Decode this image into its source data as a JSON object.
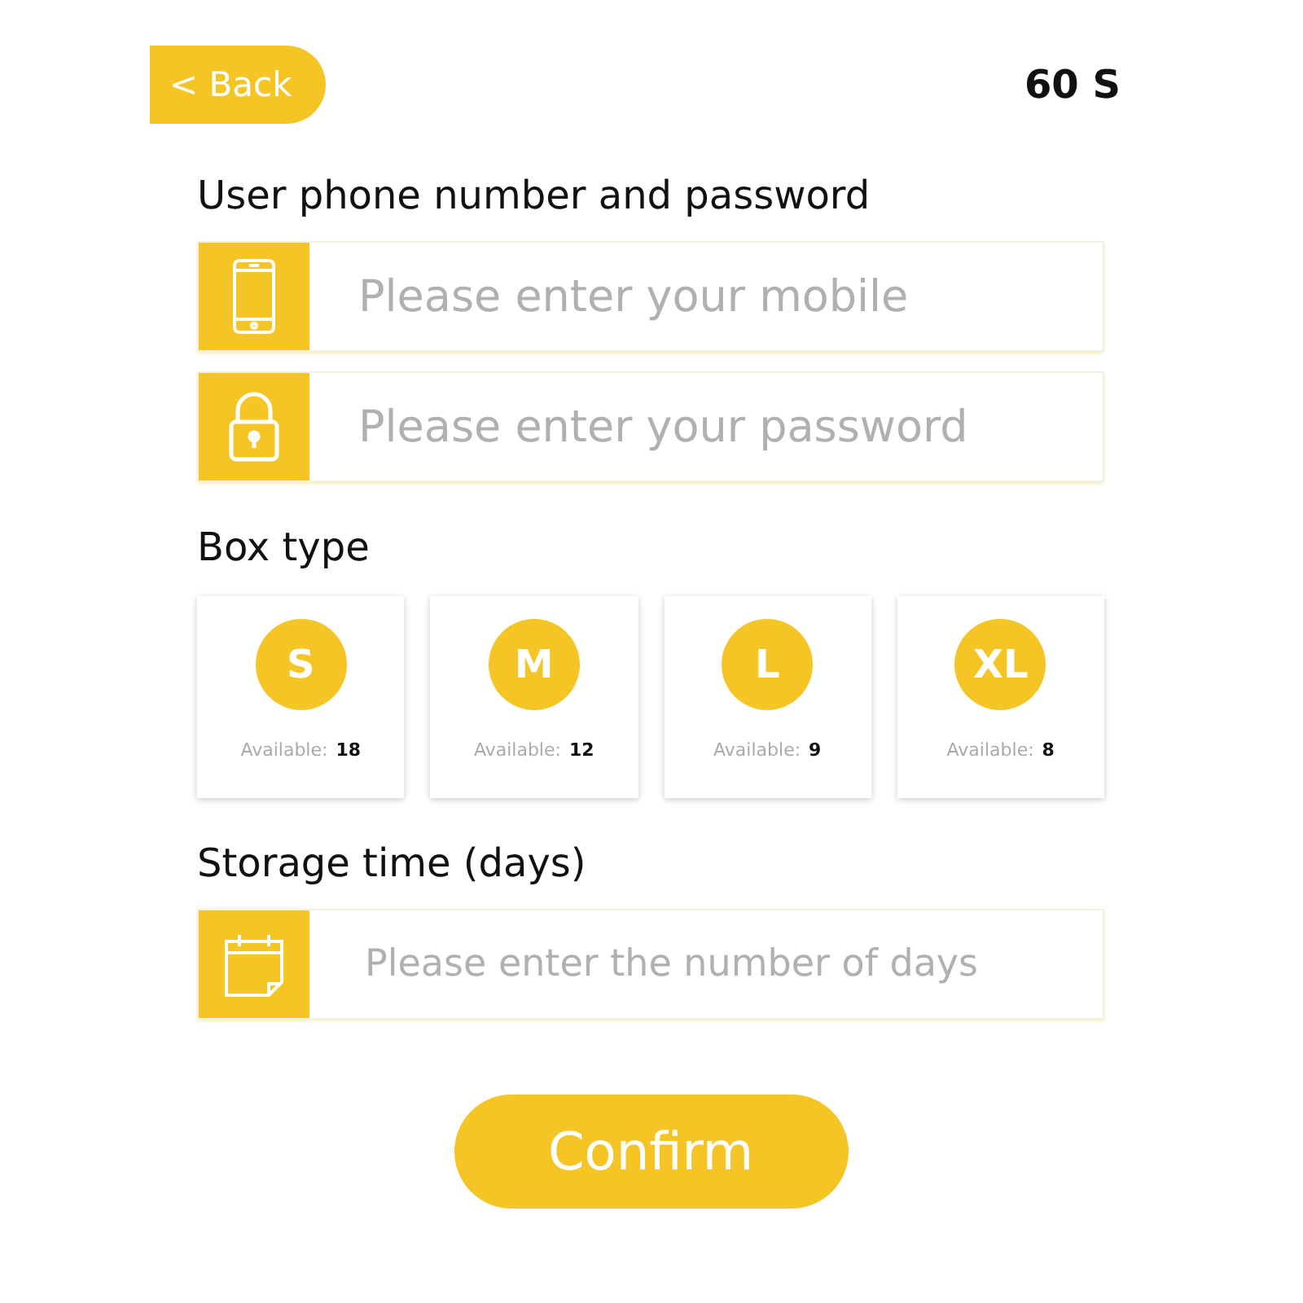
{
  "header": {
    "back": "< Back",
    "timer": "60 S"
  },
  "login": {
    "title": "User phone number and password",
    "fields": [
      {
        "kind": "phone",
        "placeholder": "Please enter your mobile"
      },
      {
        "kind": "lock",
        "placeholder": "Please enter your password"
      }
    ]
  },
  "box_type": {
    "title": "Box type",
    "options": [
      {
        "size": "S",
        "label": "Available:",
        "count": "18"
      },
      {
        "size": "M",
        "label": "Available:",
        "count": "12"
      },
      {
        "size": "L",
        "label": "Available:",
        "count": "9"
      },
      {
        "size": "XL",
        "label": "Available:",
        "count": "8"
      }
    ]
  },
  "storage": {
    "title": "Storage time (days)",
    "field": {
      "kind": "calendar",
      "placeholder": "Please enter the number of days"
    }
  },
  "confirm": "Confirm"
}
